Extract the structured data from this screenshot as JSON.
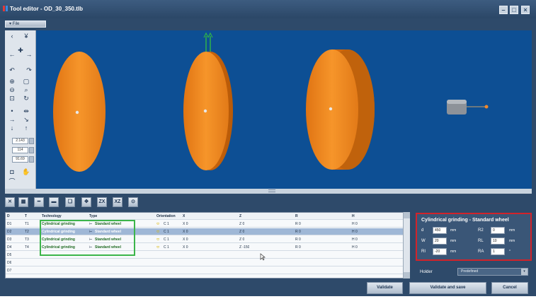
{
  "window": {
    "title": "Tool editor - OD_30_350.tlb",
    "minimize_label": "–",
    "maximize_label": "□",
    "close_label": "×"
  },
  "menu": {
    "file_label": "▾ File"
  },
  "zoom_fields": [
    "2.143",
    "114",
    "91.69"
  ],
  "table": {
    "columns": [
      "D",
      "T",
      "Technology",
      "Type",
      "Orientation",
      "X",
      "Z",
      "R",
      "H"
    ],
    "rows": [
      {
        "d": "D1",
        "t": "T1",
        "technology": "Cylindrical grinding",
        "type": "Standard wheel",
        "orientation": "C 1",
        "x": "X 0",
        "z": "Z 0",
        "r": "R 0",
        "h": "H 0"
      },
      {
        "d": "D2",
        "t": "T2",
        "technology": "Cylindrical grinding",
        "type": "Standard wheel",
        "orientation": "C 1",
        "x": "X 0",
        "z": "Z 0",
        "r": "R 0",
        "h": "H 0"
      },
      {
        "d": "D3",
        "t": "T3",
        "technology": "Cylindrical grinding",
        "type": "Standard wheel",
        "orientation": "C 1",
        "x": "X 0",
        "z": "Z 0",
        "r": "R 0",
        "h": "H 0"
      },
      {
        "d": "D4",
        "t": "T4",
        "technology": "Cylindrical grinding",
        "type": "Standard wheel",
        "orientation": "C 1",
        "x": "X 0",
        "z": "Z -150",
        "r": "R 0",
        "h": "H 0"
      },
      {
        "d": "D5",
        "t": "",
        "technology": "",
        "type": "",
        "orientation": "",
        "x": "",
        "z": "",
        "r": "",
        "h": ""
      },
      {
        "d": "D6",
        "t": "",
        "technology": "",
        "type": "",
        "orientation": "",
        "x": "",
        "z": "",
        "r": "",
        "h": ""
      },
      {
        "d": "D7",
        "t": "",
        "technology": "",
        "type": "",
        "orientation": "",
        "x": "",
        "z": "",
        "r": "",
        "h": ""
      }
    ]
  },
  "properties": {
    "title": "Cylindrical grinding - Standard wheel",
    "d_label": "d",
    "d_value": "450",
    "d_unit": "mm",
    "w_label": "W",
    "w_value": "20",
    "w_unit": "mm",
    "r_label": "RI",
    "r_value": "-20",
    "r_unit": "mm",
    "r2_label": "R2",
    "r2_value": "0",
    "r2_unit": "mm",
    "rl_label": "RL",
    "rl_value": "10",
    "rl_unit": "mm",
    "ra_label": "RA",
    "ra_value": "1",
    "ra_unit": "°"
  },
  "holder": {
    "label": "Holder",
    "value": "Predefined"
  },
  "buttons": {
    "validate": "Validate",
    "validate_save": "Validate and save",
    "cancel": "Cancel"
  },
  "colors": {
    "viewport_bg": "#0d4f94",
    "wheel": "#f08a1c",
    "selection_row": "#9fb7d6",
    "highlight_green": "#3cb54a",
    "highlight_red": "#d2232a"
  }
}
